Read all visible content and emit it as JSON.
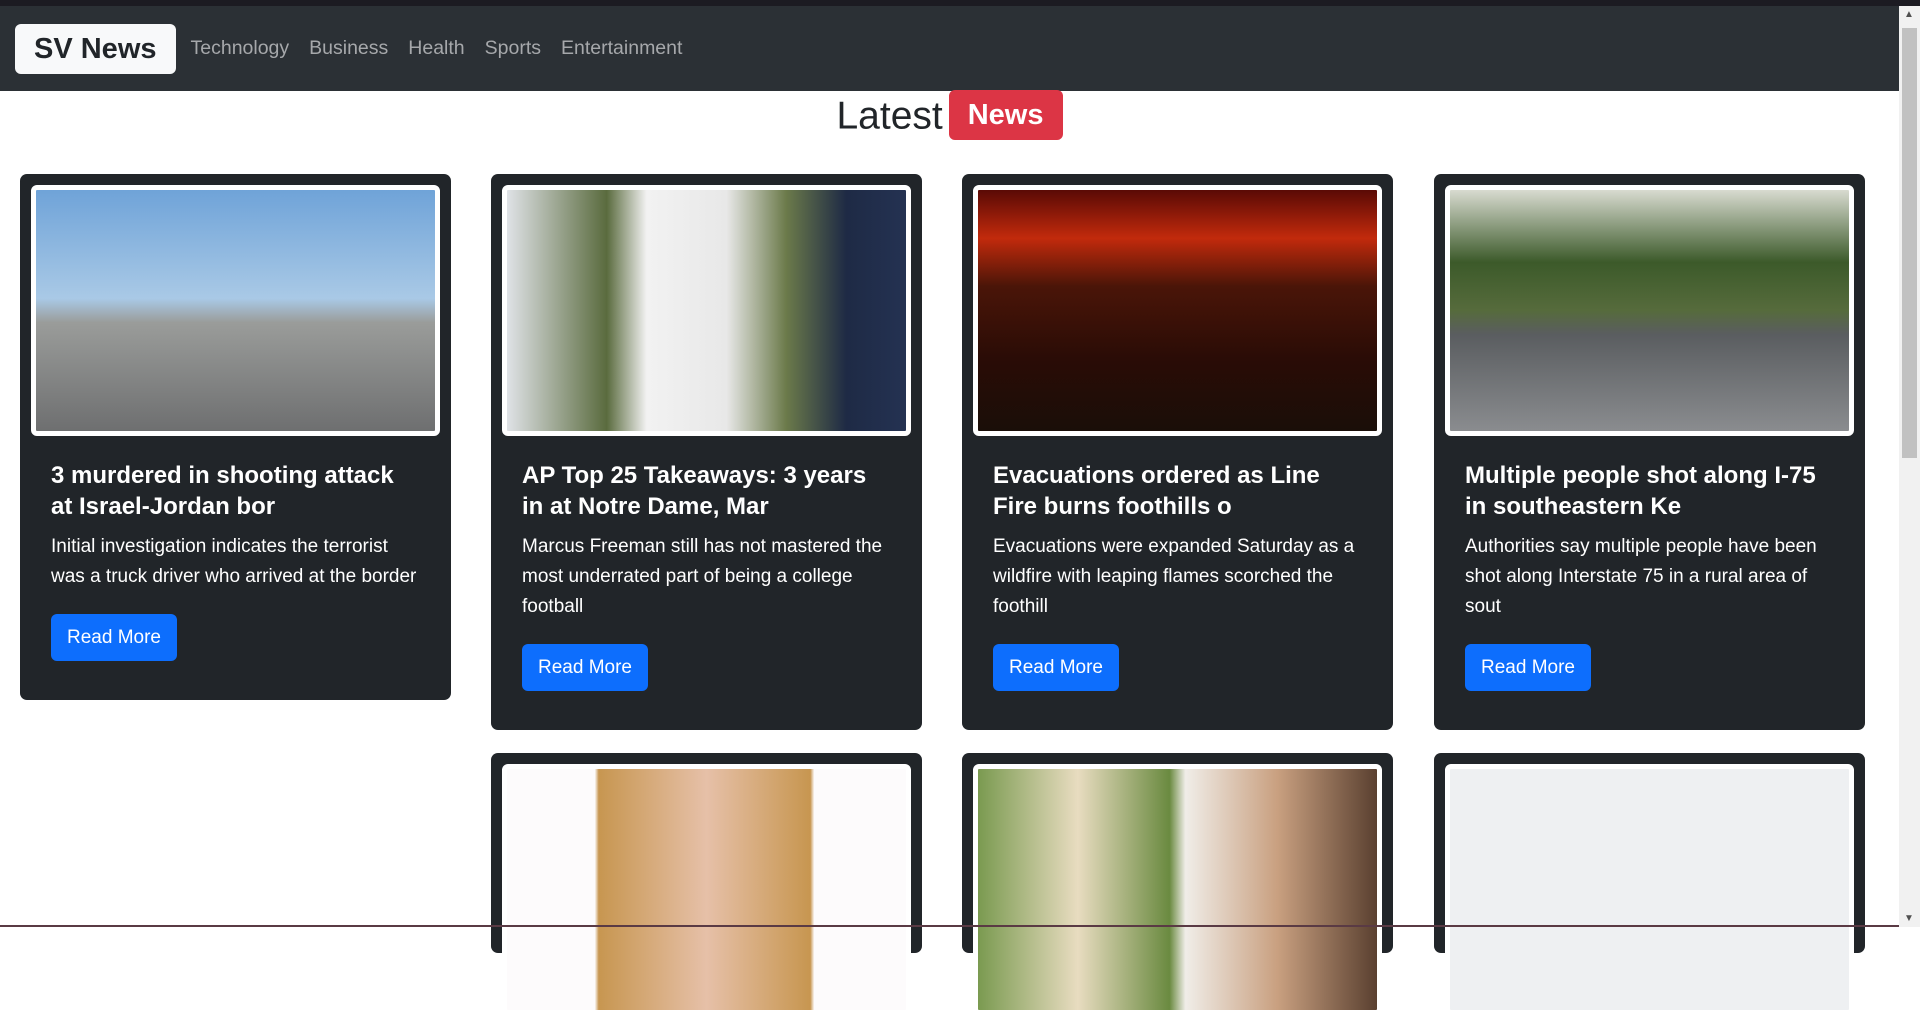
{
  "nav": {
    "brand": "SV News",
    "links": [
      "Technology",
      "Business",
      "Health",
      "Sports",
      "Entertainment"
    ]
  },
  "heading": {
    "text": "Latest",
    "badge": "News",
    "badge_color": "#dc3545"
  },
  "cards": [
    {
      "title": "3 murdered in shooting attack at Israel-Jordan bor",
      "description": "Initial investigation indicates the terrorist was a truck driver who arrived at the border",
      "button": "Read More",
      "image": "border-crossing-photo"
    },
    {
      "title": "AP Top 25 Takeaways: 3 years in at Notre Dame, Mar",
      "description": "Marcus Freeman still has not mastered the most underrated part of being a college football",
      "button": "Read More",
      "image": "football-coach-photo"
    },
    {
      "title": "Evacuations ordered as Line Fire burns foothills o",
      "description": "Evacuations were expanded Saturday as a wildfire with leaping flames scorched the foothill",
      "button": "Read More",
      "image": "wildfire-photo"
    },
    {
      "title": "Multiple people shot along I-75 in southeastern Ke",
      "description": "Authorities say multiple people have been shot along Interstate 75 in a rural area of sout",
      "button": "Read More",
      "image": "highway-photo"
    },
    {
      "image": "mugshot-photo"
    },
    {
      "image": "couple-photo"
    },
    {
      "image": "kentucky-map"
    }
  ],
  "colors": {
    "navbar": "#2b3035",
    "card": "#212529",
    "button": "#0d6efd"
  }
}
